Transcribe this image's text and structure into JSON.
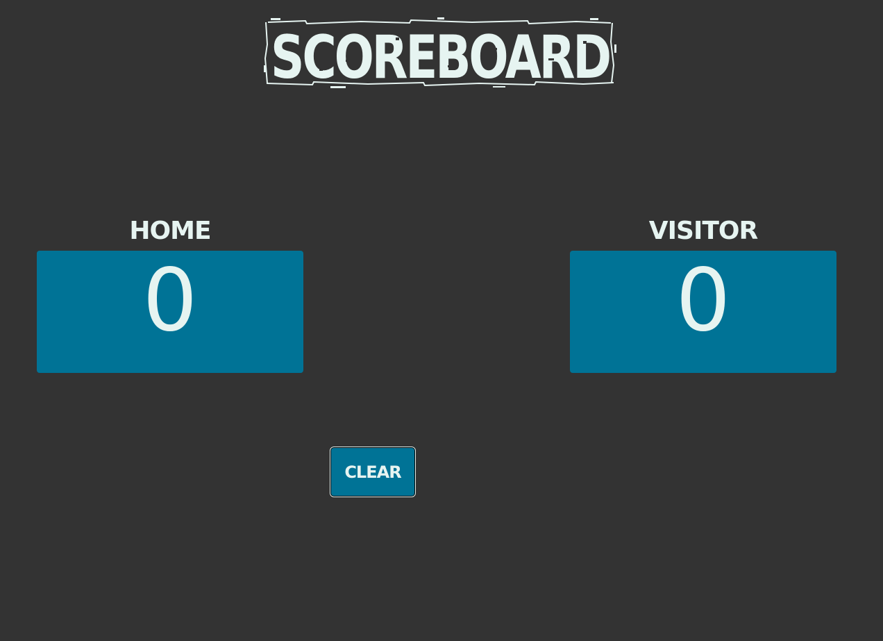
{
  "app": {
    "title": "SCOREBOARD"
  },
  "teams": [
    {
      "label": "HOME",
      "score": "0"
    },
    {
      "label": "VISITOR",
      "score": "0"
    }
  ],
  "controls": {
    "clear_label": "CLEAR"
  },
  "colors": {
    "background": "#333333",
    "accent": "#007396",
    "text": "#e6f4f1"
  }
}
